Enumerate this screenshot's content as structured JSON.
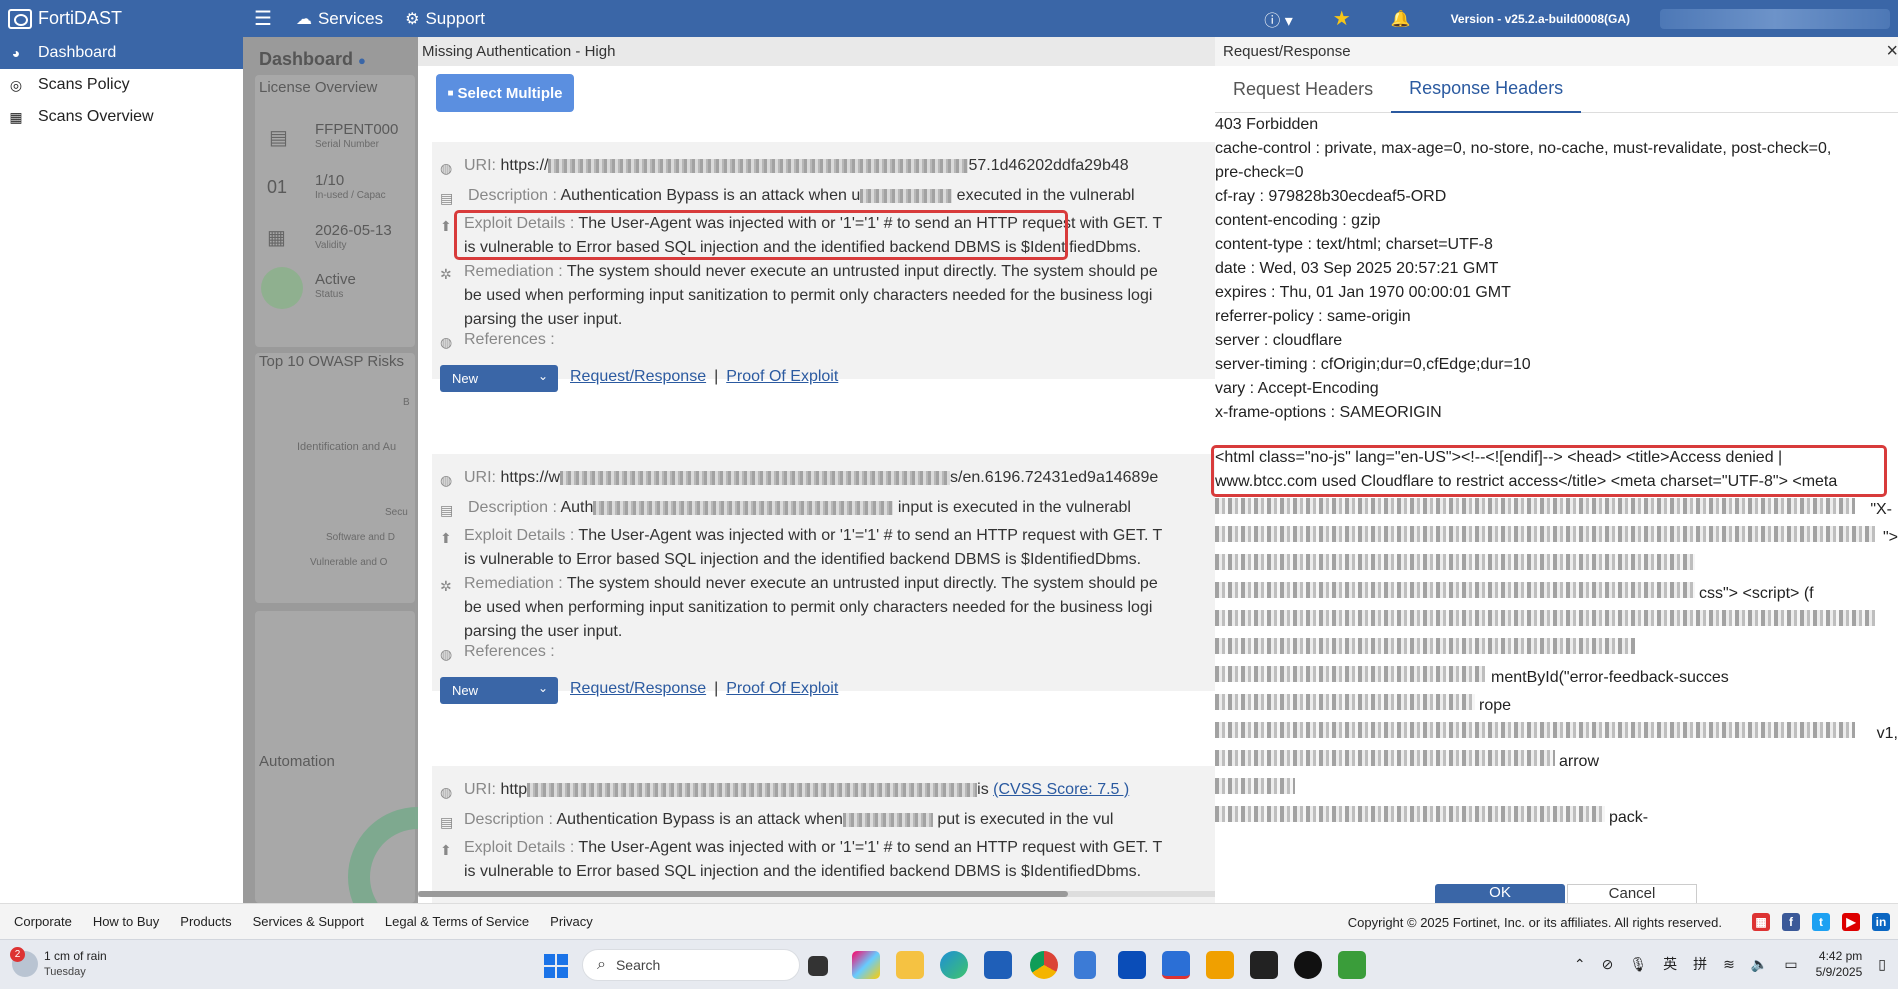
{
  "app": {
    "brand": "FortiDAST",
    "nav": {
      "services": "Services",
      "support": "Support"
    },
    "version": "Version - v25.2.a-build0008(GA)"
  },
  "sidebar": {
    "items": [
      {
        "label": "Dashboard",
        "icon": "dashboard-icon"
      },
      {
        "label": "Scans Policy",
        "icon": "policy-icon"
      },
      {
        "label": "Scans Overview",
        "icon": "grid-icon"
      }
    ]
  },
  "dashboard": {
    "title": "Dashboard",
    "license_title": "License Overview",
    "serial_value": "FFPENT000",
    "serial_label": "Serial Number",
    "inuse_value": "1/10",
    "inuse_label": "In-used / Capac",
    "inuse_num": "01",
    "validity_value": "2026-05-13",
    "validity_label": "Validity",
    "status_value": "Active",
    "status_label": "Status",
    "owasp_title": "Top 10 OWASP Risks",
    "owasp_items": [
      "B",
      "Identification and Au",
      "Secu",
      "Software and D",
      "Vulnerable and O"
    ],
    "automation_title": "Automation"
  },
  "middle": {
    "title": "Missing Authentication - High",
    "select_multiple": "Select Multiple",
    "labels": {
      "uri": "URI:",
      "description": "Description :",
      "exploit": "Exploit Details :",
      "remediation": "Remediation :",
      "references": "References :"
    },
    "vulns": [
      {
        "uri_prefix": "https://",
        "uri_suffix": "57.1d46202ddfa29b48",
        "description": "Authentication Bypass is an attack when u",
        "description_tail": "executed in the vulnerabl",
        "exploit_1": "The User-Agent was injected with or '1'='1' # to send an HTTP request with GET. T",
        "exploit_2": "is vulnerable to Error based SQL injection and the identified backend DBMS is $IdentifiedDbms.",
        "remediation_1": "The system should never execute an untrusted input directly. The system should pe",
        "remediation_2": "be used when performing input sanitization to permit only characters needed for the business logi",
        "remediation_3": "parsing the user input.",
        "status": "New",
        "link_rr": "Request/Response",
        "link_poe": "Proof Of Exploit"
      },
      {
        "uri_prefix": "https://w",
        "uri_suffix": "s/en.6196.72431ed9a14689e",
        "description": "Auth",
        "description_tail": "input is executed in the vulnerabl",
        "exploit_1": "The User-Agent was injected with or '1'='1' # to send an HTTP request with GET. T",
        "exploit_2": "is vulnerable to Error based SQL injection and the identified backend DBMS is $IdentifiedDbms.",
        "remediation_1": "The system should never execute an untrusted input directly. The system should pe",
        "remediation_2": "be used when performing input sanitization to permit only characters needed for the business logi",
        "remediation_3": "parsing the user input.",
        "status": "New",
        "link_rr": "Request/Response",
        "link_poe": "Proof Of Exploit"
      },
      {
        "uri_prefix": "http",
        "uri_suffix": "is",
        "cvss": "(CVSS Score: 7.5 )",
        "description": "Authentication Bypass is an attack when",
        "description_tail": "put is executed in the vul",
        "exploit_1": "The User-Agent was injected with or '1'='1' # to send an HTTP request with GET. T",
        "exploit_2": "is vulnerable to Error based SQL injection and the identified backend DBMS is $IdentifiedDbms."
      }
    ]
  },
  "right": {
    "title": "Request/Response",
    "tabs": [
      "Request Headers",
      "Response Headers"
    ],
    "headers": [
      "403 Forbidden",
      "cache-control : private, max-age=0, no-store, no-cache, must-revalidate, post-check=0,",
      "pre-check=0",
      "cf-ray : 979828b30ecdeaf5-ORD",
      "content-encoding : gzip",
      "content-type : text/html; charset=UTF-8",
      "date : Wed, 03 Sep 2025 20:57:21 GMT",
      "expires : Thu, 01 Jan 1970 00:00:01 GMT",
      "referrer-policy : same-origin",
      "server : cloudflare",
      "server-timing : cfOrigin;dur=0,cfEdge;dur=10",
      "vary : Accept-Encoding",
      "x-frame-options : SAMEORIGIN"
    ],
    "body_line_1": "<html class=\"no-js\" lang=\"en-US\"><!--<![endif]-->  <head> <title>Access denied |",
    "body_line_2": "www.btcc.com used Cloudflare to restrict access</title> <meta charset=\"UTF-8\"> <meta",
    "body_frag_1": "\"X-",
    "body_frag_2": "\">",
    "body_frag_3": "css\"> <script> (f",
    "body_frag_4": "mentById(\"error-feedback-succes",
    "body_frag_5": "rope",
    "body_frag_6": "v1,",
    "body_frag_7": "arrow",
    "body_frag_8": "pack-",
    "ok": "OK",
    "cancel": "Cancel"
  },
  "footer": {
    "links": [
      "Corporate",
      "How to Buy",
      "Products",
      "Services & Support",
      "Legal & Terms of Service",
      "Privacy"
    ],
    "copyright": "Copyright © 2025 Fortinet, Inc. or its affiliates. All rights reserved."
  },
  "taskbar": {
    "weather_badge": "2",
    "weather": "1 cm of rain",
    "weather_sub": "Tuesday",
    "search_placeholder": "Search",
    "lang_1": "英",
    "lang_2": "拼",
    "time": "4:42 pm",
    "date": "5/9/2025"
  }
}
